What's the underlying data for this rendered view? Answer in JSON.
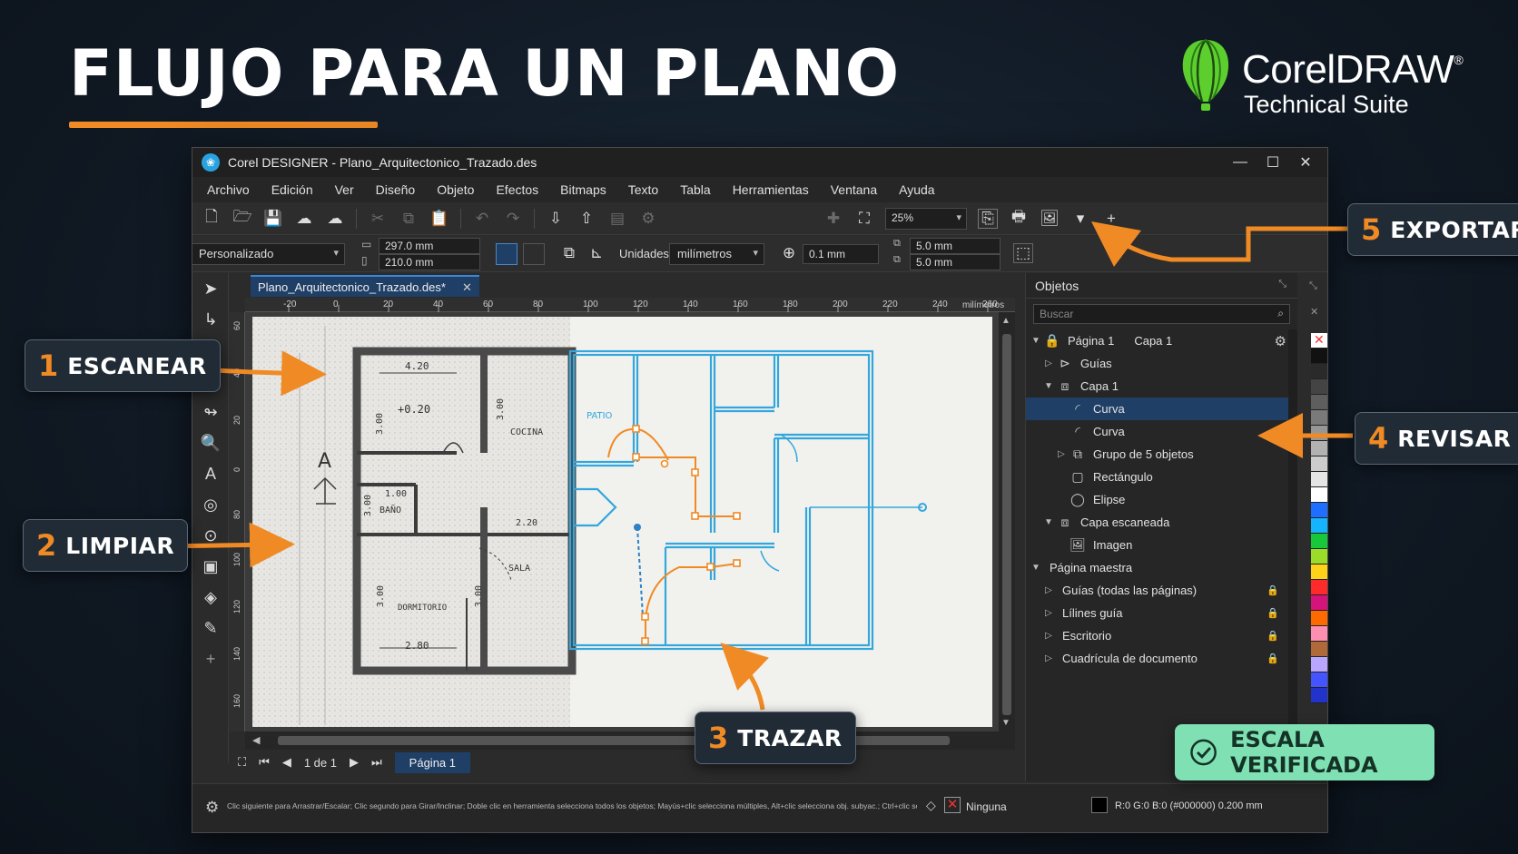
{
  "headline": "FLUJO PARA UN PLANO",
  "brand": {
    "name": "CorelDRAW",
    "mark": "®",
    "sub": "Technical Suite"
  },
  "window": {
    "title": "Corel DESIGNER - Plano_Arquitectonico_Trazado.des",
    "controls": {
      "minimize": "—",
      "maximize": "☐",
      "close": "✕"
    }
  },
  "menu": [
    "Archivo",
    "Edición",
    "Ver",
    "Diseño",
    "Objeto",
    "Efectos",
    "Bitmaps",
    "Texto",
    "Tabla",
    "Herramientas",
    "Ventana",
    "Ayuda"
  ],
  "toolbar": {
    "zoom": "25%"
  },
  "propbar": {
    "preset": "Personalizado",
    "width": "297.0 mm",
    "height": "210.0 mm",
    "units_label": "Unidades:",
    "units": "milímetros",
    "nudge": "0.1 mm",
    "dup_x": "5.0 mm",
    "dup_y": "5.0 mm"
  },
  "document_tab": {
    "name": "Plano_Arquitectonico_Trazado.des*",
    "close": "✕"
  },
  "ruler": {
    "ticks": [
      "-20",
      "0",
      "20",
      "40",
      "60",
      "80",
      "100",
      "120",
      "140",
      "160",
      "180",
      "200",
      "220",
      "240",
      "260",
      "280"
    ],
    "unit": "milímetros",
    "vticks": [
      "60",
      "40",
      "20",
      "0",
      "80",
      "100",
      "120",
      "140",
      "160"
    ]
  },
  "drawing": {
    "scan_labels": {
      "dim1": "4.20",
      "level": "+0.20",
      "cocina": "COCINA",
      "dim300a": "3.00",
      "dim300b": "3.00",
      "bano": "BAÑO",
      "dim100": "1.00",
      "dim300c": "3.00",
      "dim220": "2.20",
      "sala": "SALA",
      "dormitorio": "DORMITORIO",
      "dim300d": "3.00",
      "dim280": "2.80",
      "north": "A"
    },
    "patio": "PATIO"
  },
  "pagebar": {
    "position": "1 de 1",
    "page": "Página 1"
  },
  "status": {
    "hint": "Clic siguiente para Arrastrar/Escalar; Clic segundo para Girar/Inclinar; Doble clic en herramienta selecciona todos los objetos; Mayús+clic selecciona múltiples, Alt+clic selecciona obj. subyac.; Ctrl+clic selecciona obj. de grupo",
    "fill": "Ninguna",
    "outline": "R:0 G:0 B:0 (#000000)  0.200 mm"
  },
  "objects_panel": {
    "title": "Objetos",
    "search_placeholder": "Buscar",
    "page": "Página 1",
    "layer_tab": "Capa 1",
    "rows": [
      {
        "label": "Guías",
        "indent": 1,
        "icon": "guides-icon"
      },
      {
        "label": "Capa 1",
        "indent": 1,
        "icon": "layer-icon"
      },
      {
        "label": "Curva",
        "indent": 2,
        "icon": "curve-icon",
        "selected": true
      },
      {
        "label": "Curva",
        "indent": 2,
        "icon": "curve-icon"
      },
      {
        "label": "Grupo de 5 objetos",
        "indent": 2,
        "icon": "group-icon"
      },
      {
        "label": "Rectángulo",
        "indent": 2,
        "icon": "rectangle-icon"
      },
      {
        "label": "Elipse",
        "indent": 2,
        "icon": "ellipse-icon"
      },
      {
        "label": "Capa escaneada",
        "indent": 1,
        "icon": "layer-icon"
      },
      {
        "label": "Imagen",
        "indent": 2,
        "icon": "image-icon"
      },
      {
        "label": "Página maestra",
        "indent": 0,
        "icon": ""
      },
      {
        "label": "Guías (todas las páginas)",
        "indent": 1,
        "icon": ""
      },
      {
        "label": "Lílines guía",
        "indent": 1,
        "icon": ""
      },
      {
        "label": "Escritorio",
        "indent": 1,
        "icon": ""
      },
      {
        "label": "Cuadrícula de documento",
        "indent": 1,
        "icon": ""
      }
    ]
  },
  "palette": [
    "#ffffff",
    "#111111",
    "#2a2a2a",
    "#444444",
    "#5e5e5e",
    "#7a7a7a",
    "#969696",
    "#b2b2b2",
    "#cccccc",
    "#e6e6e6",
    "#ffffff",
    "#1e6fff",
    "#14b4ff",
    "#17c93a",
    "#9bdc28",
    "#ffd21a",
    "#ff2a2a",
    "#d4147a",
    "#ff6a00",
    "#ff8fb0",
    "#b06a3a",
    "#b9a7ff",
    "#4455ff",
    "#2233cc"
  ],
  "callouts": [
    {
      "num": "1",
      "text": "ESCANEAR"
    },
    {
      "num": "2",
      "text": "LIMPIAR"
    },
    {
      "num": "3",
      "text": "TRAZAR"
    },
    {
      "num": "4",
      "text": "REVISAR"
    },
    {
      "num": "5",
      "text": "EXPORTAR"
    }
  ],
  "badge": "ESCALA VERIFICADA",
  "colors": {
    "accent": "#f08a24",
    "trace_blue": "#33a7dc",
    "badge_green": "#7fe0b3",
    "selection": "#1f3f66"
  }
}
